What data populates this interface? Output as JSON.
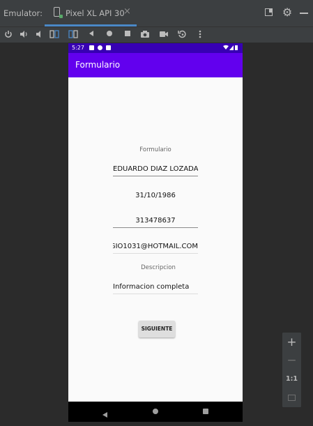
{
  "ide": {
    "tool_window_title": "Emulator:",
    "device_tab": {
      "label": "Pixel XL API 30",
      "close_glyph": "×",
      "icon": "phone-icon"
    },
    "window_icons": [
      "restore-icon",
      "gear-icon",
      "minimize-icon"
    ],
    "accent_color": "#4a88c7"
  },
  "toolbar": {
    "buttons": [
      "power-icon",
      "volume-up-icon",
      "volume-down-icon",
      "rotate-left-icon",
      "rotate-right-icon",
      "back-icon",
      "home-icon",
      "overview-icon",
      "screenshot-icon",
      "screen-record-icon",
      "snapshot-icon",
      "more-icon"
    ]
  },
  "phone": {
    "status_bar": {
      "time": "5:27"
    },
    "app_bar": {
      "title": "Formulario",
      "color": "#6200ee"
    },
    "status_bar_color": "#3700b3",
    "form": {
      "header_label": "Formulario",
      "name_value": "EDUARDO DIAZ LOZADA",
      "birth_date_value": "31/10/1986",
      "phone_value": "313478637",
      "email_value": "GIO1031@HOTMAIL.COM",
      "description_label": "Descripcion",
      "description_value": "Informacion completa",
      "next_button_label": "SIGUIENTE"
    }
  },
  "zoom_panel": {
    "zoom_in": "+",
    "zoom_out": "−",
    "actual_size": "1:1",
    "fit_icon": "fit-screen-icon"
  }
}
